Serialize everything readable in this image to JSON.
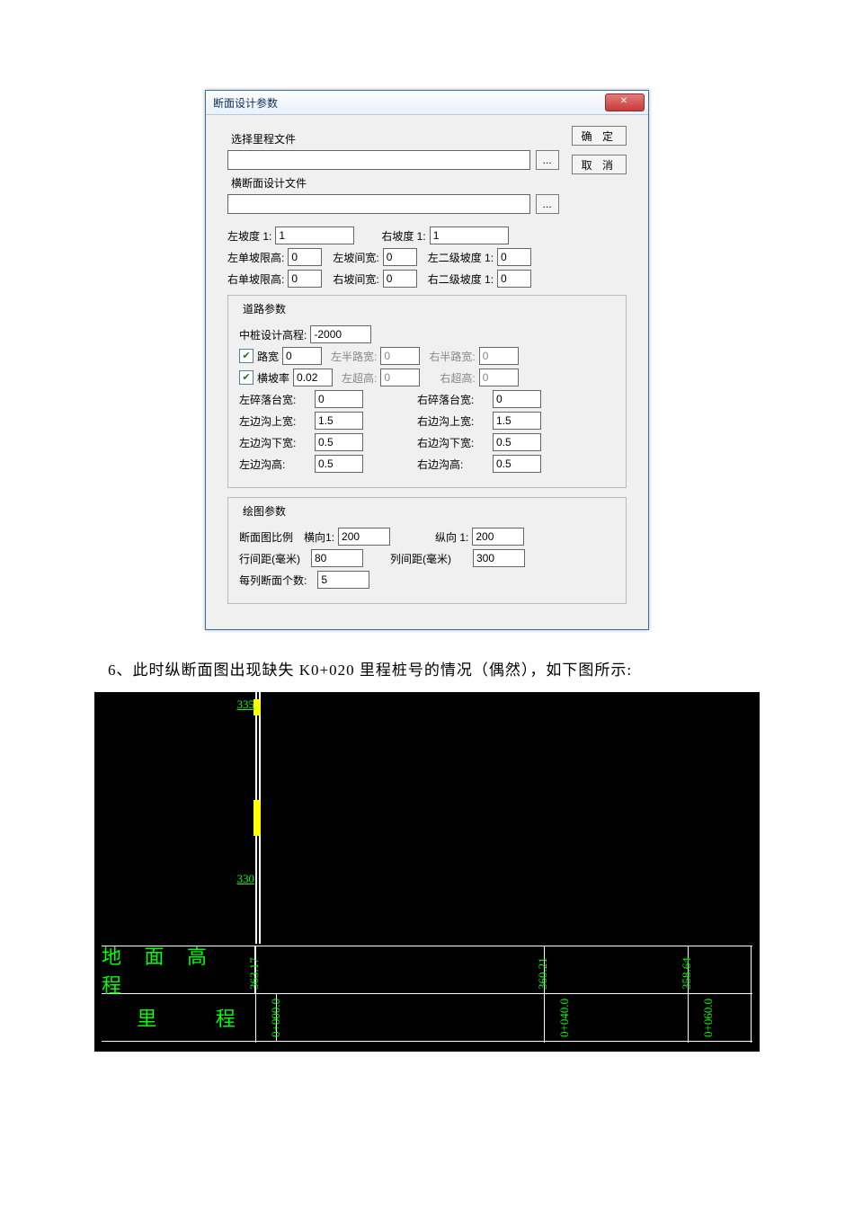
{
  "dialog": {
    "title": "断面设计参数",
    "close": "✕",
    "select_mileage_label": "选择里程文件",
    "cross_section_file_label": "横断面设计文件",
    "browse_btn": "...",
    "ok_btn": "确 定",
    "cancel_btn": "取 消",
    "left_slope_label": "左坡度 1:",
    "left_slope_value": "1",
    "right_slope_label": "右坡度 1:",
    "right_slope_value": "1",
    "left_single_slope_h_label": "左单坡限高:",
    "left_single_slope_h_value": "0",
    "left_slope_gap_label": "左坡间宽:",
    "left_slope_gap_value": "0",
    "left_sec_slope_label": "左二级坡度 1:",
    "left_sec_slope_value": "0",
    "right_single_slope_h_label": "右单坡限高:",
    "right_single_slope_h_value": "0",
    "right_slope_gap_label": "右坡间宽:",
    "right_slope_gap_value": "0",
    "right_sec_slope_label": "右二级坡度 1:",
    "right_sec_slope_value": "0",
    "road_params_title": "道路参数",
    "center_stake_elev_label": "中桩设计高程:",
    "center_stake_elev_value": "-2000",
    "road_width_cb": "路宽",
    "road_width_value": "0",
    "left_half_width_label": "左半路宽:",
    "left_half_width_value": "0",
    "right_half_width_label": "右半路宽:",
    "right_half_width_value": "0",
    "cross_slope_cb": "横坡率",
    "cross_slope_value": "0.02",
    "left_super_label": "左超高:",
    "left_super_value": "0",
    "right_super_label": "右超高:",
    "right_super_value": "0",
    "left_bench_w_label": "左碎落台宽:",
    "left_bench_w_value": "0",
    "right_bench_w_label": "右碎落台宽:",
    "right_bench_w_value": "0",
    "left_ditch_top_label": "左边沟上宽:",
    "left_ditch_top_value": "1.5",
    "right_ditch_top_label": "右边沟上宽:",
    "right_ditch_top_value": "1.5",
    "left_ditch_bot_label": "左边沟下宽:",
    "left_ditch_bot_value": "0.5",
    "right_ditch_bot_label": "右边沟下宽:",
    "right_ditch_bot_value": "0.5",
    "left_ditch_h_label": "左边沟高:",
    "left_ditch_h_value": "0.5",
    "right_ditch_h_label": "右边沟高:",
    "right_ditch_h_value": "0.5",
    "draw_params_title": "绘图参数",
    "scale_label": "断面图比例",
    "horiz_label": "横向1:",
    "horiz_value": "200",
    "vert_label": "纵向 1:",
    "vert_value": "200",
    "row_gap_label": "行间距(毫米)",
    "row_gap_value": "80",
    "col_gap_label": "列间距(毫米)",
    "col_gap_value": "300",
    "per_col_label": "每列断面个数:",
    "per_col_value": "5"
  },
  "caption": "6、此时纵断面图出现缺失 K0+020 里程桩号的情况（偶然），如下图所示:",
  "profile": {
    "y_ticks": [
      "335",
      "330"
    ],
    "row1_label": "地 面 高 程",
    "row2_label": "里     程",
    "elev_values": [
      "363.17",
      "360.21",
      "358.64"
    ],
    "mileage_values": [
      "0+000.0",
      "0+040.0",
      "0+060.0"
    ]
  }
}
